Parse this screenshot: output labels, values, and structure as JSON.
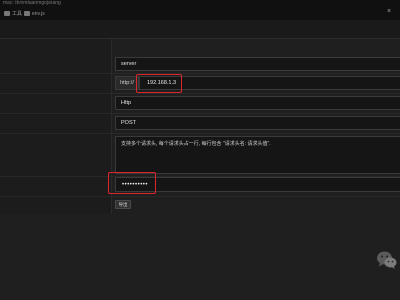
{
  "topbar": {
    "path": "mac: ttvnmtaanmgojarang",
    "crumbs": [
      {
        "label": "工具",
        "icon": "folder-icon"
      },
      {
        "label": "env.js",
        "icon": "file-icon"
      }
    ],
    "close": "×"
  },
  "form": {
    "server_value": "server",
    "protocol_prefix": "http://",
    "host_value": "192.168.1.3",
    "type_value": "Http",
    "method_value": "POST",
    "headers_placeholder": "支持多个请求头, 每个请求头占一行, 每行包含 \"请求头名: 请求头值\".",
    "password_value": "••••••••••",
    "save_button": "导出"
  },
  "watermark": {
    "icon": "wechat-icon"
  },
  "colors": {
    "highlight": "#d9262c",
    "background": "#1f1f1f"
  }
}
